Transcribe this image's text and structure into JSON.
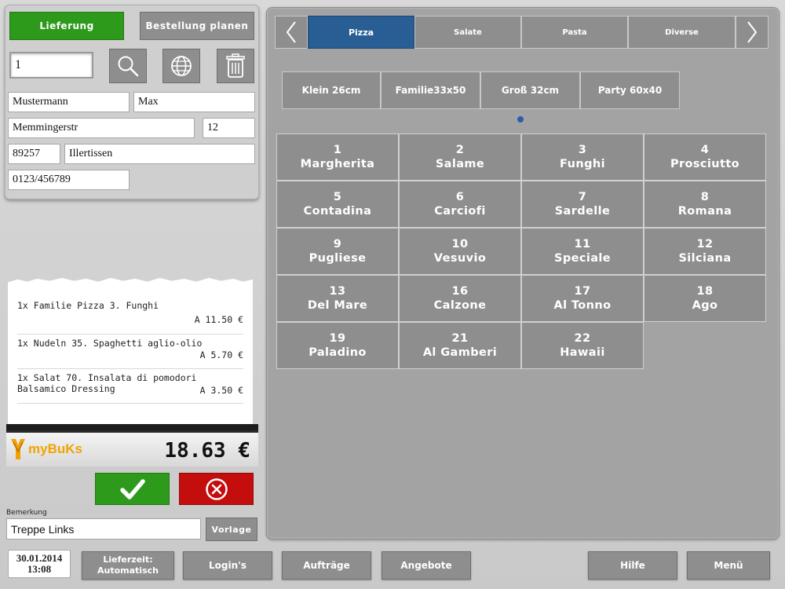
{
  "order_mode": {
    "delivery_label": "Lieferung",
    "plan_label": "Bestellung planen"
  },
  "customer": {
    "number": "1",
    "last_name": "Mustermann",
    "first_name": "Max",
    "street": "Memmingerstr",
    "house_number": "12",
    "zip": "89257",
    "city": "Illertissen",
    "phone": "0123/456789"
  },
  "receipt": {
    "items": [
      {
        "line1": "1x Familie Pizza 3. Funghi",
        "line2": "",
        "price": "A 11.50 €"
      },
      {
        "line1": "1x Nudeln 35. Spaghetti aglio-olio",
        "line2": "",
        "price": "A 5.70 €"
      },
      {
        "line1": "1x Salat 70. Insalata di pomodori",
        "line2": "Balsamico Dressing",
        "price": "A 3.50 €"
      }
    ],
    "total": "18.63 €",
    "logo_text": "myBuKs"
  },
  "remark": {
    "label": "Bemerkung",
    "value": "Treppe Links",
    "template_label": "Vorlage"
  },
  "datetime": {
    "date": "30.01.2014",
    "time": "13:08"
  },
  "bottom_bar": {
    "delivery_time": "Lieferzeit:\nAutomatisch",
    "logins": "Login's",
    "orders": "Aufträge",
    "offers": "Angebote",
    "help": "Hilfe",
    "menu": "Menü"
  },
  "categories": {
    "tabs": [
      "Pizza",
      "Salate",
      "Pasta",
      "Diverse"
    ],
    "active": "Pizza"
  },
  "sizes": [
    "Klein 26cm",
    "Familie33x50",
    "Groß 32cm",
    "Party 60x40"
  ],
  "products": [
    {
      "num": "1",
      "name": "Margherita"
    },
    {
      "num": "2",
      "name": "Salame"
    },
    {
      "num": "3",
      "name": "Funghi"
    },
    {
      "num": "4",
      "name": "Prosciutto"
    },
    {
      "num": "5",
      "name": "Contadina"
    },
    {
      "num": "6",
      "name": "Carciofi"
    },
    {
      "num": "7",
      "name": "Sardelle"
    },
    {
      "num": "8",
      "name": "Romana"
    },
    {
      "num": "9",
      "name": "Pugliese"
    },
    {
      "num": "10",
      "name": "Vesuvio"
    },
    {
      "num": "11",
      "name": "Speciale"
    },
    {
      "num": "12",
      "name": "Silciana"
    },
    {
      "num": "13",
      "name": "Del Mare"
    },
    {
      "num": "16",
      "name": "Calzone"
    },
    {
      "num": "17",
      "name": "Al Tonno"
    },
    {
      "num": "18",
      "name": "Ago"
    },
    {
      "num": "19",
      "name": "Paladino"
    },
    {
      "num": "21",
      "name": "Al Gamberi"
    },
    {
      "num": "22",
      "name": "Hawaii"
    }
  ],
  "colors": {
    "green": "#2e9a1c",
    "red": "#c40d0d",
    "active_tab": "#295e95",
    "button_grey": "#8e8e8e",
    "logo_orange": "#f2a200"
  }
}
